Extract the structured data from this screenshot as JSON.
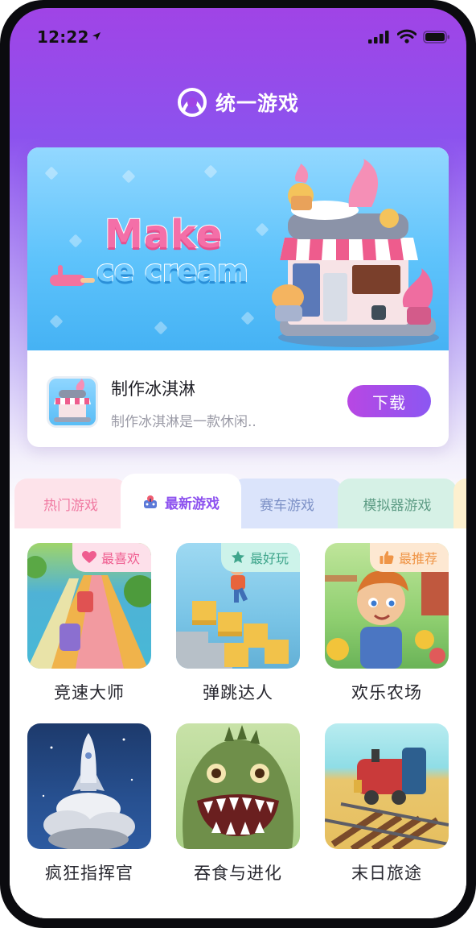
{
  "status_bar": {
    "time": "12:22"
  },
  "header": {
    "title": "统一游戏"
  },
  "featured": {
    "banner_line1": "Make",
    "banner_line2": "ce cream",
    "name": "制作冰淇淋",
    "description": "制作冰淇淋是一款休闲..",
    "download_label": "下载"
  },
  "tabs": [
    {
      "label": "热门游戏"
    },
    {
      "label": "最新游戏",
      "active": true
    },
    {
      "label": "赛车游戏"
    },
    {
      "label": "模拟器游戏"
    }
  ],
  "games": [
    {
      "name": "竞速大师",
      "badge": "最喜欢",
      "badge_icon": "heart-icon"
    },
    {
      "name": "弹跳达人",
      "badge": "最好玩",
      "badge_icon": "star-icon"
    },
    {
      "name": "欢乐农场",
      "badge": "最推荐",
      "badge_icon": "thumbs-up-icon"
    },
    {
      "name": "疯狂指挥官"
    },
    {
      "name": "吞食与进化"
    },
    {
      "name": "末日旅途"
    }
  ],
  "colors": {
    "accent": "#8d52ef",
    "header_gradient_top": "#a044e6",
    "download_gradient": [
      "#b847e3",
      "#8b57f2"
    ]
  }
}
